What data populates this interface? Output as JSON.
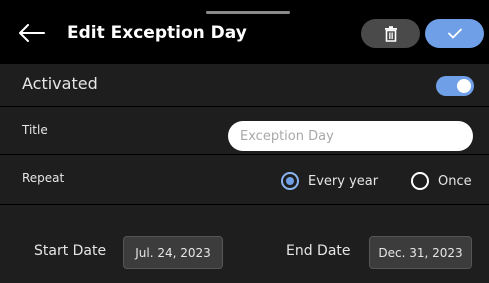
{
  "header": {
    "title": "Edit Exception Day",
    "back_icon": "arrow-left-icon",
    "delete_icon": "trash-icon",
    "confirm_icon": "check-icon"
  },
  "activated": {
    "label": "Activated",
    "on": true
  },
  "title_field": {
    "label": "Title",
    "placeholder": "Exception Day",
    "value": ""
  },
  "repeat": {
    "label": "Repeat",
    "options": [
      {
        "label": "Every year",
        "selected": true
      },
      {
        "label": "Once",
        "selected": false
      }
    ]
  },
  "dates": {
    "start_label": "Start Date",
    "start_value": "Jul. 24, 2023",
    "end_label": "End Date",
    "end_value": "Dec. 31, 2023"
  },
  "colors": {
    "accent": "#6f9fe6",
    "background": "#000000",
    "panel": "#1e1e1e",
    "delete_button": "#4a4a4a"
  }
}
